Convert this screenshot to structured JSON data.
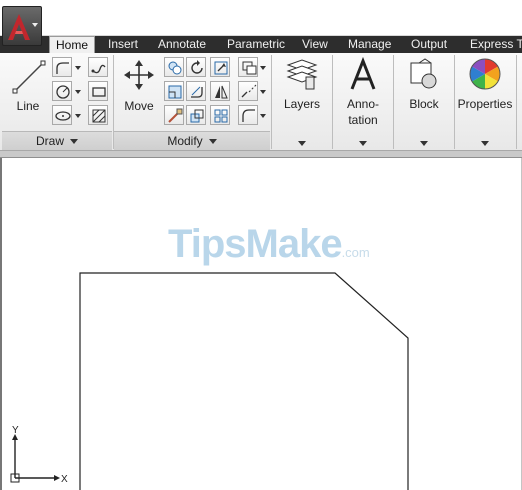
{
  "ribbon_tabs": [
    "Home",
    "Insert",
    "Annotate",
    "Parametric",
    "View",
    "Manage",
    "Output",
    "Express To"
  ],
  "panels": {
    "draw": {
      "title": "Draw",
      "line_label": "Line"
    },
    "modify": {
      "title": "Modify",
      "move_label": "Move"
    },
    "layers": {
      "label": "Layers"
    },
    "annotation": {
      "label_line1": "Anno-",
      "label_line2": "tation"
    },
    "block": {
      "label": "Block"
    },
    "properties": {
      "label": "Properties"
    }
  },
  "watermark": {
    "main": "TipsMake",
    "suffix": ".com"
  },
  "ucs": {
    "x_label": "X",
    "y_label": "Y"
  },
  "colors": {
    "tabbar": "#2d2d2d",
    "ribbon": "#f0f0f0",
    "watermark": "#b9d6ea",
    "logo_red": "#c1272d"
  }
}
